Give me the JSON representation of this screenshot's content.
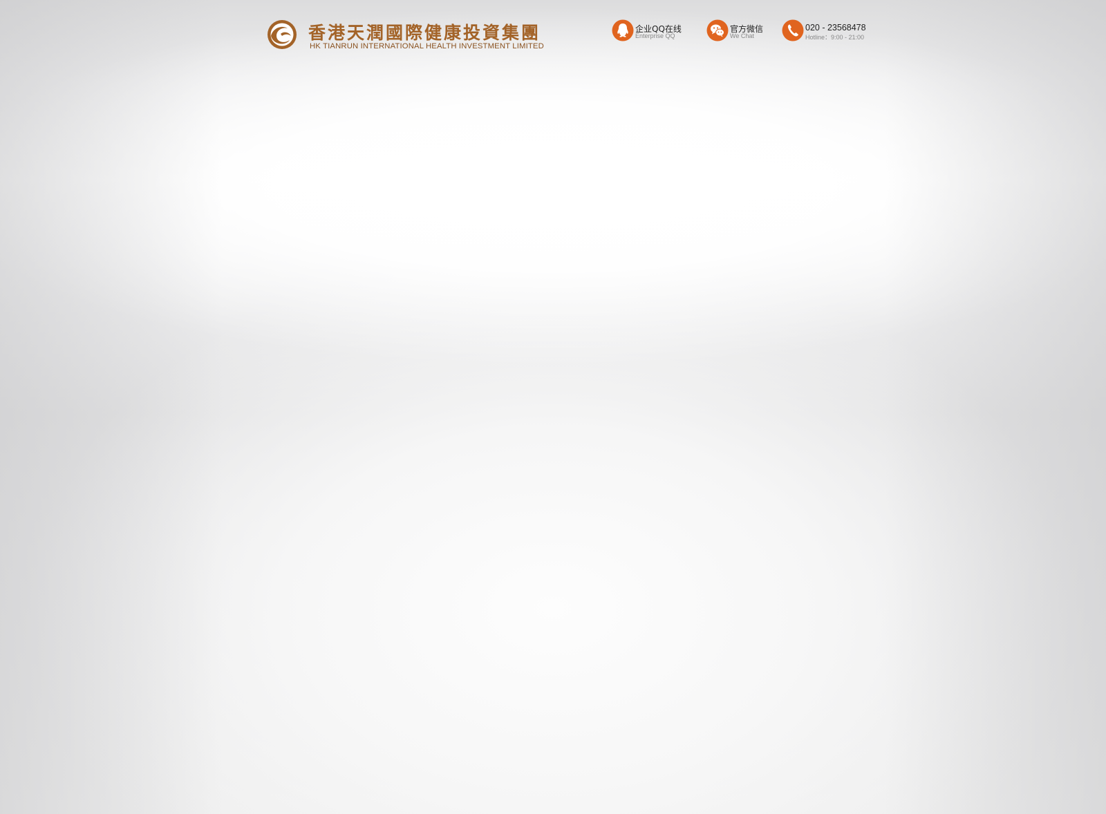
{
  "header": {
    "logo": {
      "chinese_name": "香港天潤國際健康投資集團",
      "english_name": "HK TIANRUN INTERNATIONAL HEALTH INVESTMENT LIMITED",
      "brand_color": "#a36328"
    },
    "contacts": {
      "qq": {
        "icon": "qq-penguin-icon",
        "label": "企业QQ在线",
        "sublabel": "Enterprise QQ"
      },
      "wechat": {
        "icon": "wechat-icon",
        "label": "官方微信",
        "sublabel": "We Chat"
      },
      "phone": {
        "icon": "phone-icon",
        "number": "020 - 23568478",
        "hours": "Hotline：9:00 - 21:00"
      },
      "accent_color": "#e0641f"
    }
  }
}
